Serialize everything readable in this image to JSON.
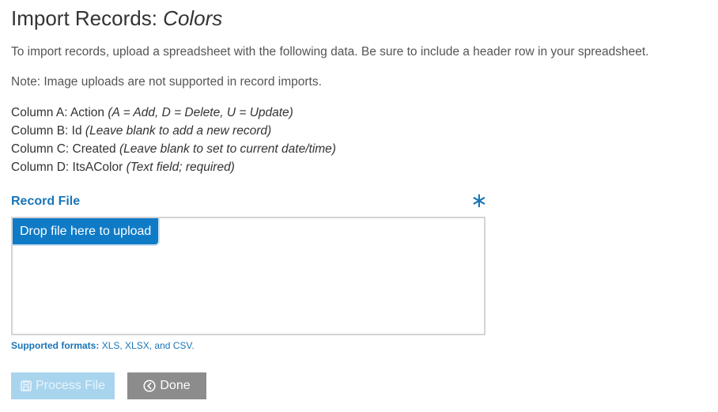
{
  "header": {
    "title_prefix": "Import Records: ",
    "title_entity": "Colors"
  },
  "instructions": {
    "intro": "To import records, upload a spreadsheet with the following data. Be sure to include a header row in your spreadsheet.",
    "note": "Note: Image uploads are not supported in record imports."
  },
  "columns": [
    {
      "label": "Column A: Action",
      "hint": "(A = Add, D = Delete, U = Update)"
    },
    {
      "label": "Column B: Id",
      "hint": "(Leave blank to add a new record)"
    },
    {
      "label": "Column C: Created",
      "hint": "(Leave blank to set to current date/time)"
    },
    {
      "label": "Column D: ItsAColor",
      "hint": "(Text field; required)"
    }
  ],
  "record_file": {
    "label": "Record File",
    "required_mark": "∗",
    "drop_label": "Drop file here to upload",
    "formats_label": "Supported formats:",
    "formats_value": "XLS, XLSX, and CSV."
  },
  "actions": {
    "process_label": "Process File",
    "process_icon": "save-disk-icon",
    "done_label": "Done",
    "done_icon": "circle-chevron-left-icon"
  },
  "colors": {
    "accent": "#1a75b8",
    "drop_button": "#0f7bc7",
    "process_disabled": "#a9d4ee",
    "done_gray": "#8c8c8c"
  }
}
